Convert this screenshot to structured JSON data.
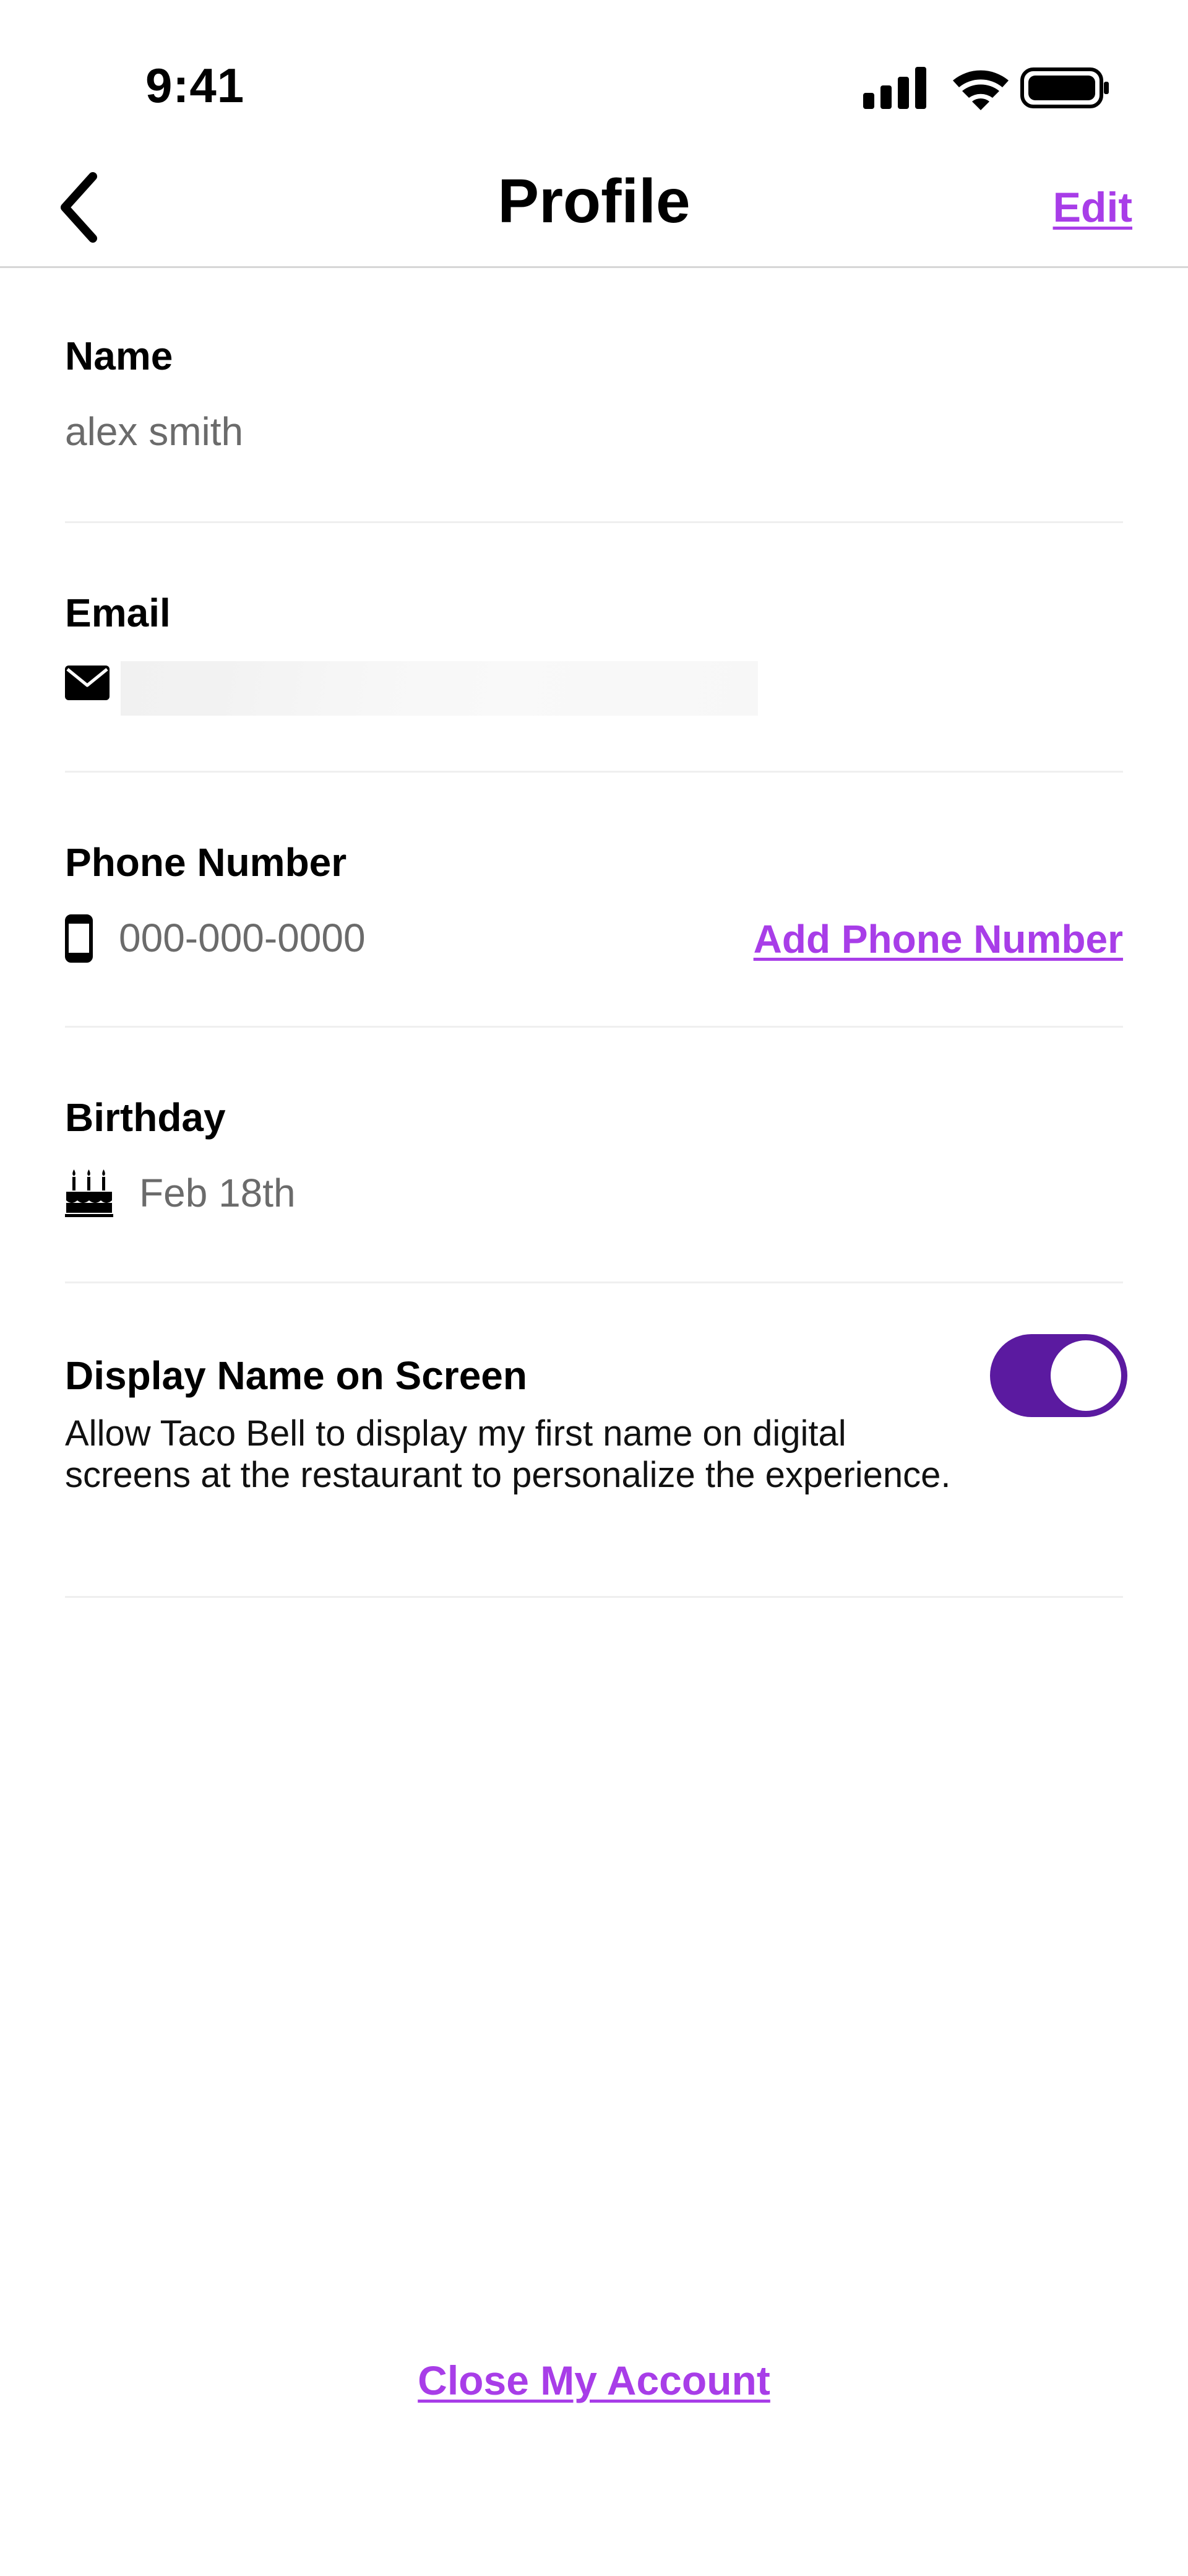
{
  "status_bar": {
    "time": "9:41",
    "icons": [
      "cellular-signal-icon",
      "wifi-icon",
      "battery-icon"
    ]
  },
  "header": {
    "title": "Profile",
    "edit_label": "Edit",
    "back_icon": "chevron-left-icon"
  },
  "profile": {
    "name": {
      "label": "Name",
      "value": "alex smith"
    },
    "email": {
      "label": "Email",
      "icon": "envelope-icon"
    },
    "phone": {
      "label": "Phone Number",
      "value": "000-000-0000",
      "icon": "mobile-phone-icon",
      "add_label": "Add Phone Number"
    },
    "birthday": {
      "label": "Birthday",
      "value": "Feb 18th",
      "icon": "birthday-cake-icon"
    },
    "display_name": {
      "label": "Display Name on Screen",
      "description": "Allow Taco Bell to display my first name on digital screens at the restaurant to personalize the experience.",
      "enabled": true
    }
  },
  "footer": {
    "close_account_label": "Close My Account"
  },
  "colors": {
    "accent": "#a83de8",
    "toggle_on": "#5b1aa0",
    "label_text": "#000000",
    "value_text": "#6b6b6b",
    "divider": "#efefef"
  }
}
